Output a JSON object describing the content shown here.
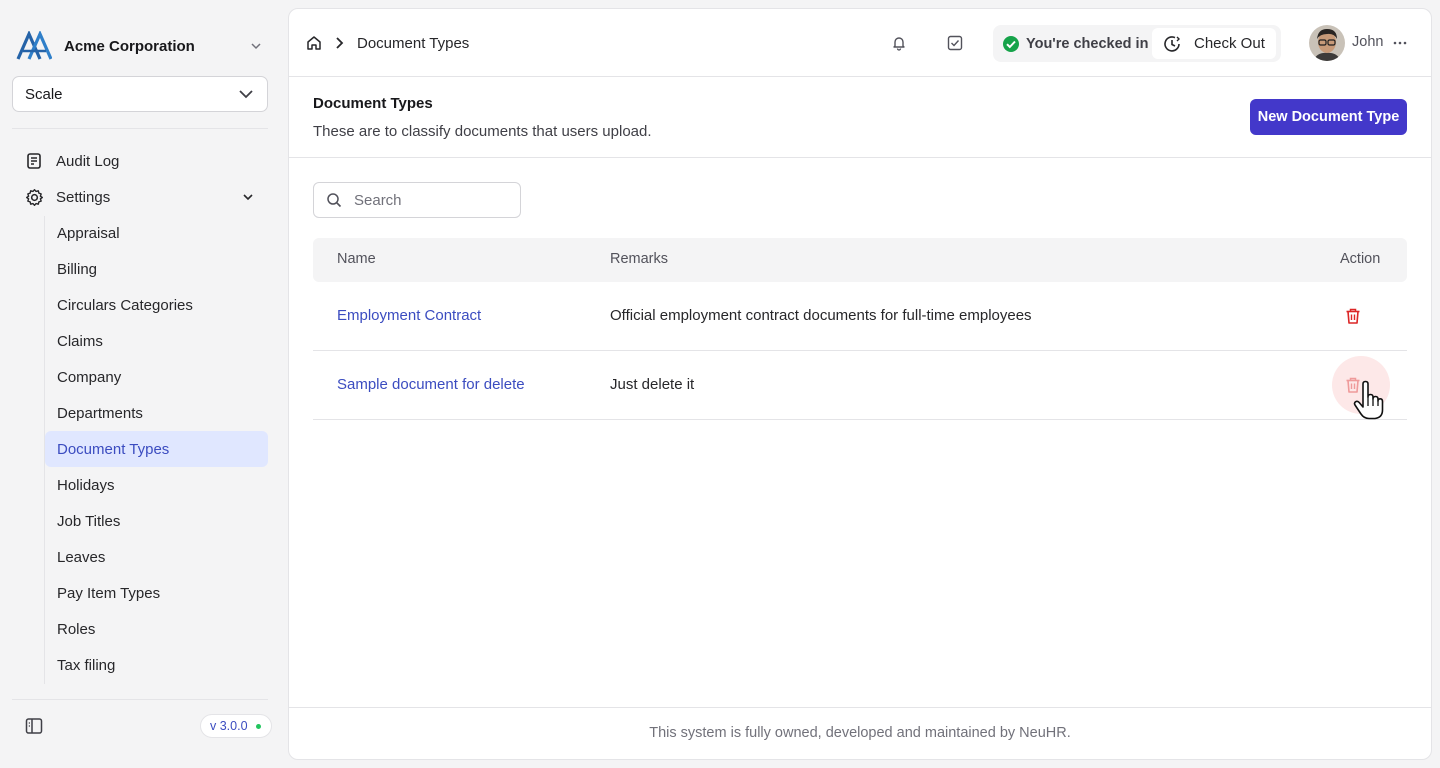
{
  "sidebar": {
    "org_name": "Acme Corporation",
    "scale_value": "Scale",
    "nav": [
      {
        "label": "Audit Log"
      },
      {
        "label": "Settings"
      }
    ],
    "settings_items": [
      {
        "label": "Appraisal"
      },
      {
        "label": "Billing"
      },
      {
        "label": "Circulars Categories"
      },
      {
        "label": "Claims"
      },
      {
        "label": "Company"
      },
      {
        "label": "Departments"
      },
      {
        "label": "Document Types"
      },
      {
        "label": "Holidays"
      },
      {
        "label": "Job Titles"
      },
      {
        "label": "Leaves"
      },
      {
        "label": "Pay Item Types"
      },
      {
        "label": "Roles"
      },
      {
        "label": "Tax filing"
      }
    ],
    "active_item": "Document Types",
    "version": "v 3.0.0"
  },
  "topbar": {
    "breadcrumb_current": "Document Types",
    "checkin_status": "You're checked in",
    "checkout_label": "Check Out",
    "user_name": "John"
  },
  "page": {
    "title": "Document Types",
    "description": "These are to classify documents that users upload.",
    "new_button": "New Document Type",
    "search_placeholder": "Search"
  },
  "table": {
    "columns": [
      "Name",
      "Remarks",
      "Action"
    ],
    "rows": [
      {
        "name": "Employment Contract",
        "remarks": "Official employment contract documents for full-time employees"
      },
      {
        "name": "Sample document for delete",
        "remarks": "Just delete it"
      }
    ]
  },
  "footer": {
    "text": "This system is fully owned, developed and maintained by NeuHR."
  },
  "colors": {
    "accent": "#4338ca",
    "link": "#3b4cc0",
    "active_bg": "#e0e7ff",
    "danger": "#dc2626",
    "success": "#16a34a"
  }
}
